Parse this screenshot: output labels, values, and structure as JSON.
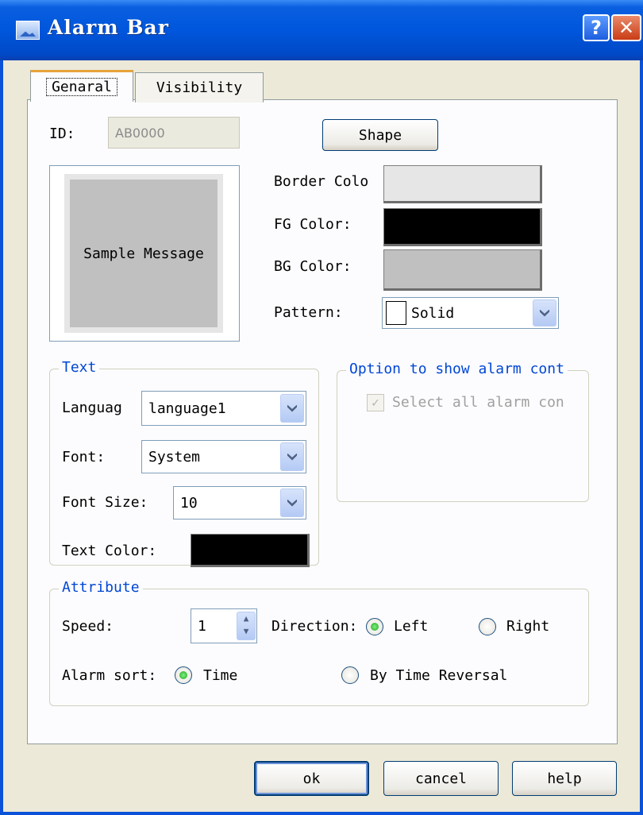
{
  "window": {
    "title": "Alarm Bar"
  },
  "tabs": [
    {
      "label": "Genaral"
    },
    {
      "label": "Visibility"
    }
  ],
  "general": {
    "id_label": "ID:",
    "id_value": "AB0000",
    "shape_button": "Shape",
    "preview_text": "Sample Message",
    "border_color_label": "Border Colo",
    "fg_color_label": "FG Color:",
    "bg_color_label": "BG Color:",
    "pattern_label": "Pattern:",
    "pattern_value": "Solid",
    "colors": {
      "border": "#e6e6e6",
      "fg": "#000000",
      "bg": "#c0c0c0",
      "preview_bg": "#c0c0c0"
    }
  },
  "text_group": {
    "title": "Text",
    "language_label": "Languag",
    "language_value": "language1",
    "font_label": "Font:",
    "font_value": "System",
    "font_size_label": "Font Size:",
    "font_size_value": "10",
    "text_color_label": "Text Color:",
    "text_color": "#000000"
  },
  "option_group": {
    "title": "Option to show alarm cont",
    "select_all_label": "Select all alarm con",
    "select_all_checked": true,
    "enabled": false
  },
  "attribute_group": {
    "title": "Attribute",
    "speed_label": "Speed:",
    "speed_value": "1",
    "direction_label": "Direction:",
    "direction_left": "Left",
    "direction_right": "Right",
    "direction_selected": "Left",
    "alarm_sort_label": "Alarm sort:",
    "sort_time": "Time",
    "sort_reversal": "By Time Reversal",
    "sort_selected": "Time"
  },
  "footer": {
    "ok": "ok",
    "cancel": "cancel",
    "help": "help"
  }
}
